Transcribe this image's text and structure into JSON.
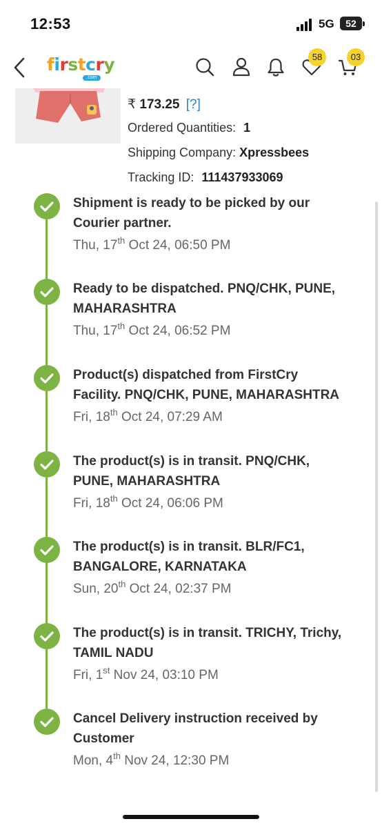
{
  "status_bar": {
    "time": "12:53",
    "network": "5G",
    "battery": "52"
  },
  "nav": {
    "logo_letters": [
      {
        "char": "f",
        "color": "#f7a21b"
      },
      {
        "char": "i",
        "color": "#2aa8e0"
      },
      {
        "char": "r",
        "color": "#e53935"
      },
      {
        "char": "s",
        "color": "#7cb342"
      },
      {
        "char": "t",
        "color": "#f7a21b"
      },
      {
        "char": "c",
        "color": "#2aa8e0"
      },
      {
        "char": "r",
        "color": "#e53935"
      },
      {
        "char": "y",
        "color": "#7cb342"
      }
    ],
    "logo_sub": ".com",
    "wishlist_count": "58",
    "cart_count": "03",
    "icons": [
      "back-icon",
      "search-icon",
      "user-icon",
      "bell-icon",
      "heart-icon",
      "cart-icon"
    ]
  },
  "order": {
    "currency": "₹",
    "price": "173.25",
    "price_help": "[?]",
    "qty_label": "Ordered Quantities:",
    "qty_value": "1",
    "ship_label": "Shipping Company:",
    "ship_value": "Xpressbees",
    "track_label": "Tracking ID:",
    "track_value": "111437933069"
  },
  "timeline": [
    {
      "title": "Shipment is ready to be picked by our Courier partner.",
      "date_pre": "Thu, 17",
      "date_sup": "th",
      "date_post": " Oct 24, 06:50 PM"
    },
    {
      "title": "Ready to be dispatched. PNQ/CHK, PUNE, MAHARASHTRA",
      "date_pre": "Thu, 17",
      "date_sup": "th",
      "date_post": " Oct 24, 06:52 PM"
    },
    {
      "title": "Product(s) dispatched from FirstCry Facility. PNQ/CHK, PUNE, MAHARASHTRA",
      "date_pre": "Fri, 18",
      "date_sup": "th",
      "date_post": " Oct 24, 07:29 AM"
    },
    {
      "title": "The product(s) is in transit. PNQ/CHK, PUNE, MAHARASHTRA",
      "date_pre": "Fri, 18",
      "date_sup": "th",
      "date_post": " Oct 24, 06:06 PM"
    },
    {
      "title": "The product(s) is in transit. BLR/FC1, BANGALORE, KARNATAKA",
      "date_pre": "Sun, 20",
      "date_sup": "th",
      "date_post": " Oct 24, 02:37 PM"
    },
    {
      "title": "The product(s) is in transit. TRICHY, Trichy, TAMIL NADU",
      "date_pre": "Fri, 1",
      "date_sup": "st",
      "date_post": " Nov 24, 03:10 PM"
    },
    {
      "title": "Cancel Delivery instruction received by Customer",
      "date_pre": "Mon, 4",
      "date_sup": "th",
      "date_post": " Nov 24, 12:30 PM"
    }
  ],
  "colors": {
    "accent_green": "#7cb342",
    "badge_yellow": "#f7d22b",
    "link_blue": "#2b7fd0"
  }
}
